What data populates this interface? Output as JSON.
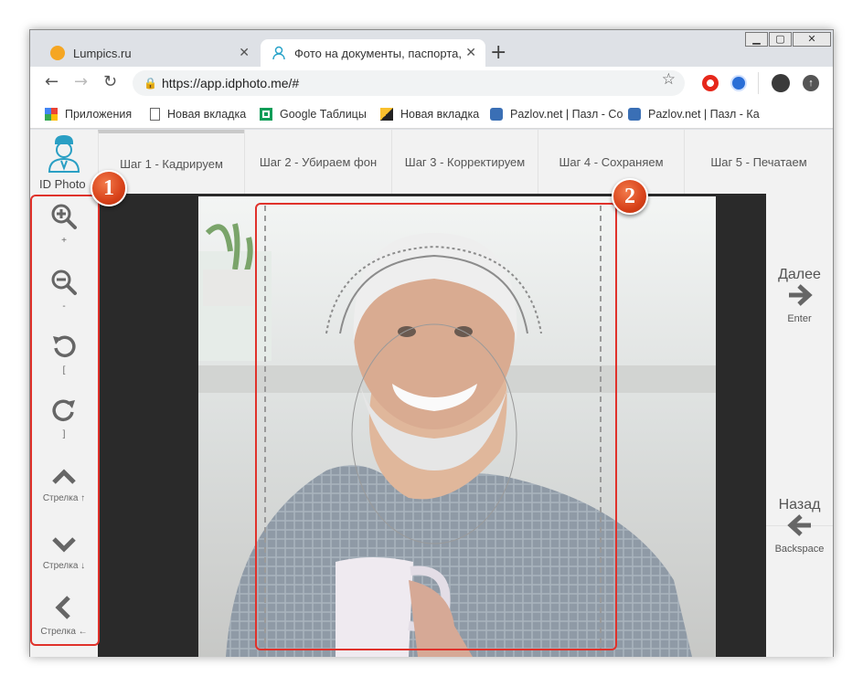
{
  "window": {
    "buttons": [
      "▁",
      "▢",
      "✕"
    ]
  },
  "tabs": [
    {
      "title": "Lumpics.ru",
      "favicon_color": "#f5a623",
      "active": false
    },
    {
      "title": "Фото на документы, паспорта, з",
      "favicon_color": "#29a3c9",
      "active": true
    }
  ],
  "newtab_icon": "+",
  "address": {
    "url": "https://app.idphoto.me/#"
  },
  "bookmarks": [
    {
      "label": "Приложения",
      "icon": "apps-grid-icon"
    },
    {
      "label": "Новая вкладка",
      "icon": "page-icon"
    },
    {
      "label": "Google Таблицы",
      "icon": "sheets-icon"
    },
    {
      "label": "Новая вкладка",
      "icon": "image-icon"
    },
    {
      "label": "Pazlov.net | Пазл - Со",
      "icon": "puzzle-icon"
    },
    {
      "label": "Pazlov.net | Пазл - Ка",
      "icon": "puzzle-icon"
    }
  ],
  "app": {
    "logo_text": "ID Photo",
    "steps": [
      "Шаг 1 - Кадрируем",
      "Шаг 2 - Убираем фон",
      "Шаг 3 - Корректируем",
      "Шаг 4 - Сохраняем",
      "Шаг 5 - Печатаем"
    ],
    "tools": [
      {
        "icon": "zoom-in-icon",
        "label": "+"
      },
      {
        "icon": "zoom-out-icon",
        "label": "-"
      },
      {
        "icon": "rotate-left-icon",
        "label": "["
      },
      {
        "icon": "rotate-right-icon",
        "label": "]"
      },
      {
        "icon": "arrow-up-icon",
        "label": "Стрелка ↑"
      },
      {
        "icon": "arrow-down-icon",
        "label": "Стрелка ↓"
      },
      {
        "icon": "arrow-left-icon",
        "label": "Стрелка ←"
      }
    ],
    "next": {
      "label": "Далее",
      "key": "Enter"
    },
    "back": {
      "label": "Назад",
      "key": "Backspace"
    }
  },
  "annotations": {
    "badge1": "1",
    "badge2": "2",
    "color": "#e0322b"
  }
}
